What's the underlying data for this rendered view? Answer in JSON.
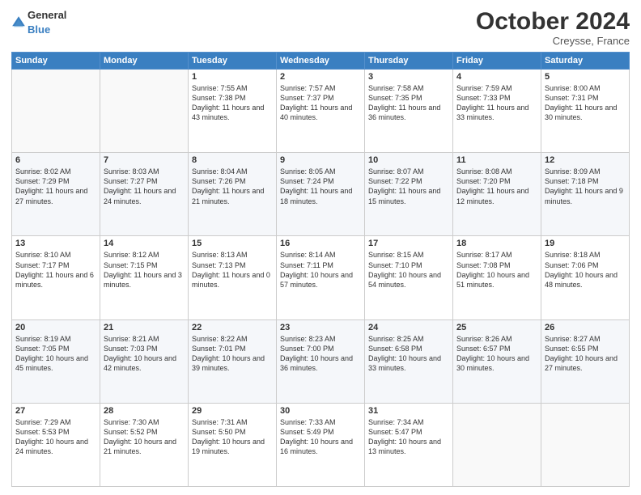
{
  "header": {
    "logo": {
      "general": "General",
      "blue": "Blue"
    },
    "title": "October 2024",
    "location": "Creysse, France"
  },
  "calendar": {
    "days": [
      "Sunday",
      "Monday",
      "Tuesday",
      "Wednesday",
      "Thursday",
      "Friday",
      "Saturday"
    ],
    "weeks": [
      [
        {
          "day": "",
          "sunrise": "",
          "sunset": "",
          "daylight": ""
        },
        {
          "day": "",
          "sunrise": "",
          "sunset": "",
          "daylight": ""
        },
        {
          "day": "1",
          "sunrise": "Sunrise: 7:55 AM",
          "sunset": "Sunset: 7:38 PM",
          "daylight": "Daylight: 11 hours and 43 minutes."
        },
        {
          "day": "2",
          "sunrise": "Sunrise: 7:57 AM",
          "sunset": "Sunset: 7:37 PM",
          "daylight": "Daylight: 11 hours and 40 minutes."
        },
        {
          "day": "3",
          "sunrise": "Sunrise: 7:58 AM",
          "sunset": "Sunset: 7:35 PM",
          "daylight": "Daylight: 11 hours and 36 minutes."
        },
        {
          "day": "4",
          "sunrise": "Sunrise: 7:59 AM",
          "sunset": "Sunset: 7:33 PM",
          "daylight": "Daylight: 11 hours and 33 minutes."
        },
        {
          "day": "5",
          "sunrise": "Sunrise: 8:00 AM",
          "sunset": "Sunset: 7:31 PM",
          "daylight": "Daylight: 11 hours and 30 minutes."
        }
      ],
      [
        {
          "day": "6",
          "sunrise": "Sunrise: 8:02 AM",
          "sunset": "Sunset: 7:29 PM",
          "daylight": "Daylight: 11 hours and 27 minutes."
        },
        {
          "day": "7",
          "sunrise": "Sunrise: 8:03 AM",
          "sunset": "Sunset: 7:27 PM",
          "daylight": "Daylight: 11 hours and 24 minutes."
        },
        {
          "day": "8",
          "sunrise": "Sunrise: 8:04 AM",
          "sunset": "Sunset: 7:26 PM",
          "daylight": "Daylight: 11 hours and 21 minutes."
        },
        {
          "day": "9",
          "sunrise": "Sunrise: 8:05 AM",
          "sunset": "Sunset: 7:24 PM",
          "daylight": "Daylight: 11 hours and 18 minutes."
        },
        {
          "day": "10",
          "sunrise": "Sunrise: 8:07 AM",
          "sunset": "Sunset: 7:22 PM",
          "daylight": "Daylight: 11 hours and 15 minutes."
        },
        {
          "day": "11",
          "sunrise": "Sunrise: 8:08 AM",
          "sunset": "Sunset: 7:20 PM",
          "daylight": "Daylight: 11 hours and 12 minutes."
        },
        {
          "day": "12",
          "sunrise": "Sunrise: 8:09 AM",
          "sunset": "Sunset: 7:18 PM",
          "daylight": "Daylight: 11 hours and 9 minutes."
        }
      ],
      [
        {
          "day": "13",
          "sunrise": "Sunrise: 8:10 AM",
          "sunset": "Sunset: 7:17 PM",
          "daylight": "Daylight: 11 hours and 6 minutes."
        },
        {
          "day": "14",
          "sunrise": "Sunrise: 8:12 AM",
          "sunset": "Sunset: 7:15 PM",
          "daylight": "Daylight: 11 hours and 3 minutes."
        },
        {
          "day": "15",
          "sunrise": "Sunrise: 8:13 AM",
          "sunset": "Sunset: 7:13 PM",
          "daylight": "Daylight: 11 hours and 0 minutes."
        },
        {
          "day": "16",
          "sunrise": "Sunrise: 8:14 AM",
          "sunset": "Sunset: 7:11 PM",
          "daylight": "Daylight: 10 hours and 57 minutes."
        },
        {
          "day": "17",
          "sunrise": "Sunrise: 8:15 AM",
          "sunset": "Sunset: 7:10 PM",
          "daylight": "Daylight: 10 hours and 54 minutes."
        },
        {
          "day": "18",
          "sunrise": "Sunrise: 8:17 AM",
          "sunset": "Sunset: 7:08 PM",
          "daylight": "Daylight: 10 hours and 51 minutes."
        },
        {
          "day": "19",
          "sunrise": "Sunrise: 8:18 AM",
          "sunset": "Sunset: 7:06 PM",
          "daylight": "Daylight: 10 hours and 48 minutes."
        }
      ],
      [
        {
          "day": "20",
          "sunrise": "Sunrise: 8:19 AM",
          "sunset": "Sunset: 7:05 PM",
          "daylight": "Daylight: 10 hours and 45 minutes."
        },
        {
          "day": "21",
          "sunrise": "Sunrise: 8:21 AM",
          "sunset": "Sunset: 7:03 PM",
          "daylight": "Daylight: 10 hours and 42 minutes."
        },
        {
          "day": "22",
          "sunrise": "Sunrise: 8:22 AM",
          "sunset": "Sunset: 7:01 PM",
          "daylight": "Daylight: 10 hours and 39 minutes."
        },
        {
          "day": "23",
          "sunrise": "Sunrise: 8:23 AM",
          "sunset": "Sunset: 7:00 PM",
          "daylight": "Daylight: 10 hours and 36 minutes."
        },
        {
          "day": "24",
          "sunrise": "Sunrise: 8:25 AM",
          "sunset": "Sunset: 6:58 PM",
          "daylight": "Daylight: 10 hours and 33 minutes."
        },
        {
          "day": "25",
          "sunrise": "Sunrise: 8:26 AM",
          "sunset": "Sunset: 6:57 PM",
          "daylight": "Daylight: 10 hours and 30 minutes."
        },
        {
          "day": "26",
          "sunrise": "Sunrise: 8:27 AM",
          "sunset": "Sunset: 6:55 PM",
          "daylight": "Daylight: 10 hours and 27 minutes."
        }
      ],
      [
        {
          "day": "27",
          "sunrise": "Sunrise: 7:29 AM",
          "sunset": "Sunset: 5:53 PM",
          "daylight": "Daylight: 10 hours and 24 minutes."
        },
        {
          "day": "28",
          "sunrise": "Sunrise: 7:30 AM",
          "sunset": "Sunset: 5:52 PM",
          "daylight": "Daylight: 10 hours and 21 minutes."
        },
        {
          "day": "29",
          "sunrise": "Sunrise: 7:31 AM",
          "sunset": "Sunset: 5:50 PM",
          "daylight": "Daylight: 10 hours and 19 minutes."
        },
        {
          "day": "30",
          "sunrise": "Sunrise: 7:33 AM",
          "sunset": "Sunset: 5:49 PM",
          "daylight": "Daylight: 10 hours and 16 minutes."
        },
        {
          "day": "31",
          "sunrise": "Sunrise: 7:34 AM",
          "sunset": "Sunset: 5:47 PM",
          "daylight": "Daylight: 10 hours and 13 minutes."
        },
        {
          "day": "",
          "sunrise": "",
          "sunset": "",
          "daylight": ""
        },
        {
          "day": "",
          "sunrise": "",
          "sunset": "",
          "daylight": ""
        }
      ]
    ]
  }
}
